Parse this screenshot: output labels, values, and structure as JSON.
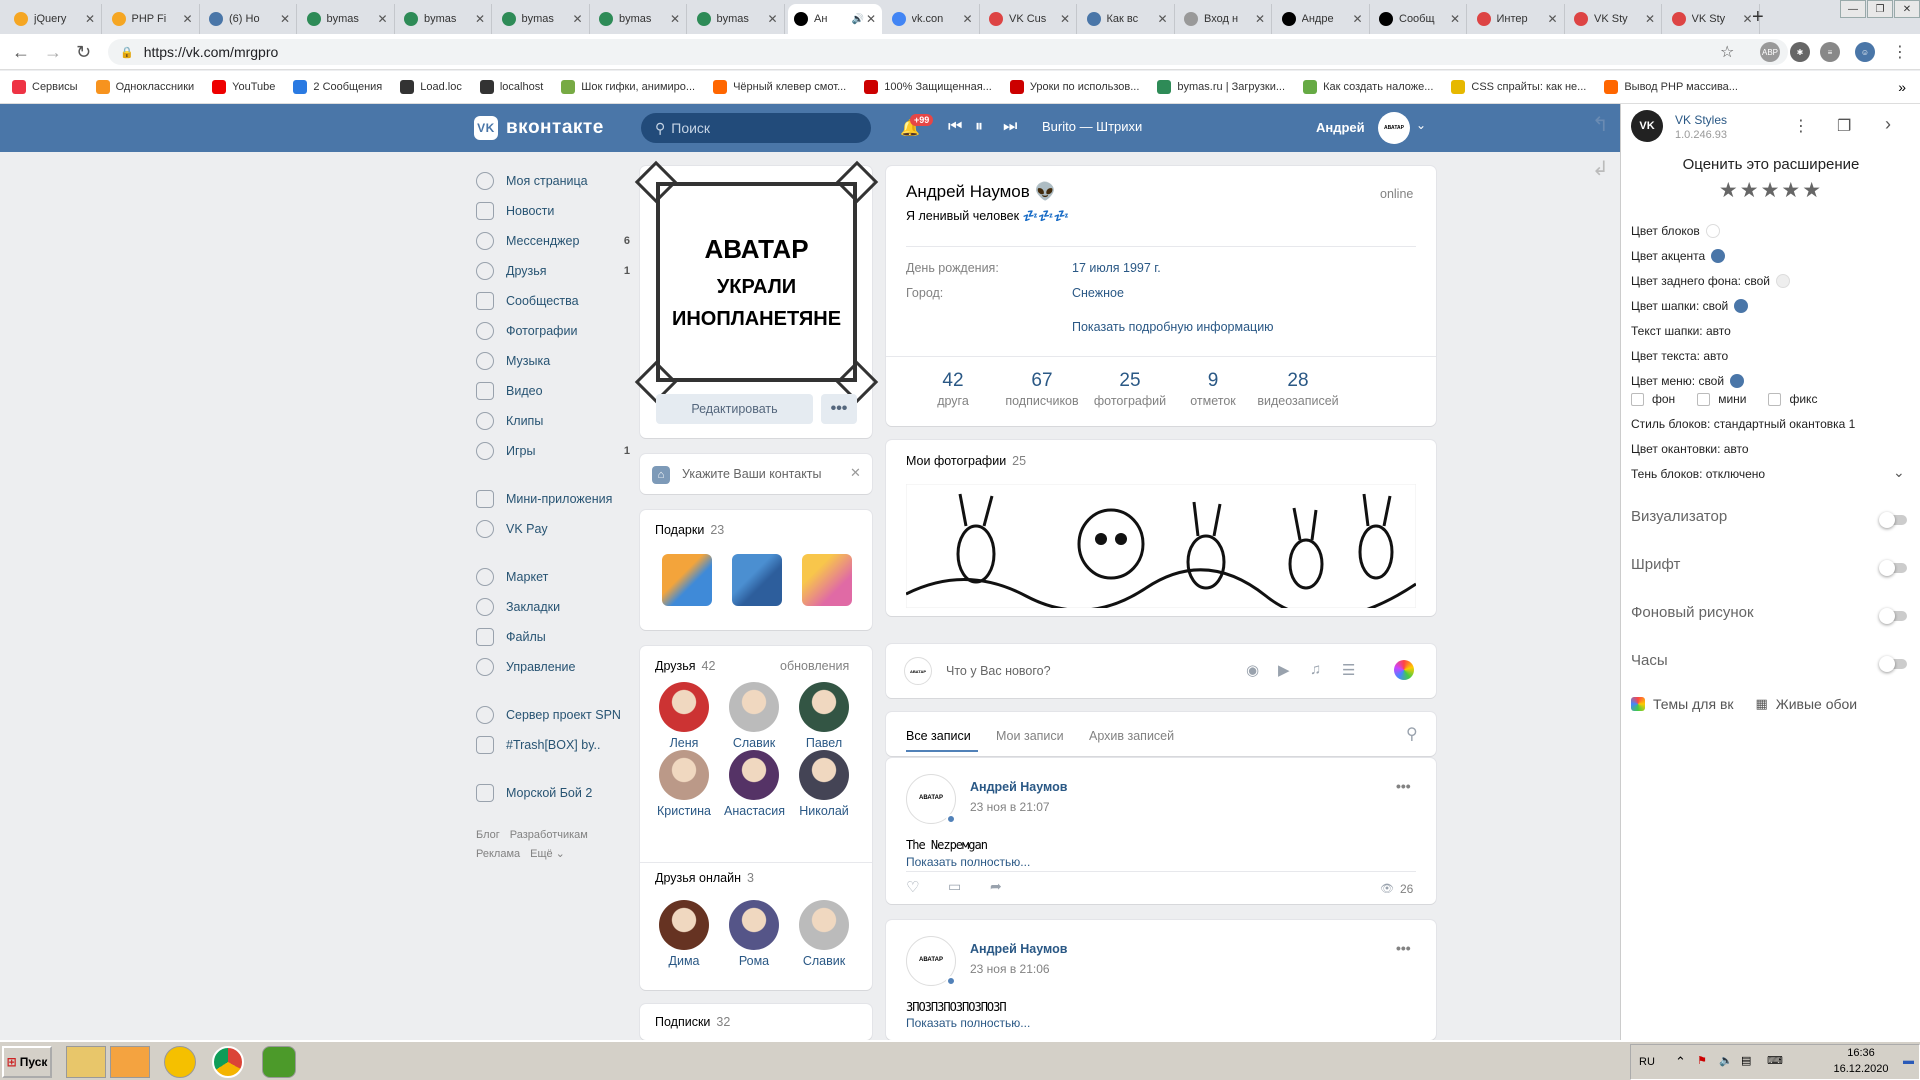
{
  "browser": {
    "tabs": [
      {
        "title": "jQuery",
        "color": "#f5a623"
      },
      {
        "title": "PHP Fi",
        "color": "#f5a623"
      },
      {
        "title": "(6) Но",
        "color": "#4a76a8"
      },
      {
        "title": "bymas",
        "color": "#2e8b57"
      },
      {
        "title": "bymas",
        "color": "#2e8b57"
      },
      {
        "title": "bymas",
        "color": "#2e8b57"
      },
      {
        "title": "bymas",
        "color": "#2e8b57"
      },
      {
        "title": "bymas",
        "color": "#2e8b57"
      },
      {
        "title": "Ан",
        "color": "#000000"
      },
      {
        "title": "vk.con",
        "color": "#4285f4"
      },
      {
        "title": "VK Cus",
        "color": "#d44"
      },
      {
        "title": "Как вс",
        "color": "#4a76a8"
      },
      {
        "title": "Вход н",
        "color": "#999999"
      },
      {
        "title": "Андре",
        "color": "#000000"
      },
      {
        "title": "Сообщ",
        "color": "#000000"
      },
      {
        "title": "Интер",
        "color": "#d44"
      },
      {
        "title": "VK Sty",
        "color": "#d44"
      },
      {
        "title": "VK Sty",
        "color": "#d44"
      }
    ],
    "new_tab": "+",
    "url": "https://vk.com/mrgpro",
    "bookmarks": [
      {
        "label": "Сервисы",
        "color": "#e34"
      },
      {
        "label": "Одноклассники",
        "color": "#f7931e"
      },
      {
        "label": "YouTube",
        "color": "#e00"
      },
      {
        "label": "2 Сообщения",
        "color": "#2a7ae2"
      },
      {
        "label": "Load.loc",
        "color": "#333"
      },
      {
        "label": "localhost",
        "color": "#333"
      },
      {
        "label": "Шок гифки, анимиро...",
        "color": "#7a4"
      },
      {
        "label": "Чёрный клевер смот...",
        "color": "#f60"
      },
      {
        "label": "100% Защищенная...",
        "color": "#c00"
      },
      {
        "label": "Уроки по использов...",
        "color": "#c00"
      },
      {
        "label": "bymas.ru | Загрузки...",
        "color": "#2e8b57"
      },
      {
        "label": "Как создать наложе...",
        "color": "#6a4"
      },
      {
        "label": "CSS спрайты: как не...",
        "color": "#e6b800"
      },
      {
        "label": "Вывод PHP массива...",
        "color": "#f60"
      }
    ]
  },
  "header": {
    "logo_text": "вконтакте",
    "search_placeholder": "Поиск",
    "notifications_badge": "+99",
    "track": "Burito — Штрихи",
    "user_name": "Андрей"
  },
  "menu": {
    "items": [
      {
        "label": "Моя страница",
        "count": ""
      },
      {
        "label": "Новости",
        "count": ""
      },
      {
        "label": "Мессенджер",
        "count": "6"
      },
      {
        "label": "Друзья",
        "count": "1"
      },
      {
        "label": "Сообщества",
        "count": ""
      },
      {
        "label": "Фотографии",
        "count": ""
      },
      {
        "label": "Музыка",
        "count": ""
      },
      {
        "label": "Видео",
        "count": ""
      },
      {
        "label": "Клипы",
        "count": ""
      },
      {
        "label": "Игры",
        "count": "1"
      }
    ],
    "items2": [
      {
        "label": "Мини-приложения"
      },
      {
        "label": "VK Pay"
      }
    ],
    "items3": [
      {
        "label": "Маркет"
      },
      {
        "label": "Закладки"
      },
      {
        "label": "Файлы"
      },
      {
        "label": "Управление"
      }
    ],
    "items4": [
      {
        "label": "Сервер проект SPN"
      },
      {
        "label": "#Trash[BOX] by.."
      }
    ],
    "items5": [
      {
        "label": "Морской Бой 2"
      }
    ],
    "footer": [
      "Блог",
      "Разработчикам",
      "Реклама",
      "Ещё ⌄"
    ]
  },
  "avatar": {
    "line1": "АВАТАР",
    "line2": "УКРАЛИ",
    "line3": "ИНОПЛАНЕТЯНЕ",
    "edit_label": "Редактировать",
    "more_label": "•••"
  },
  "contacts_prompt": "Укажите Ваши контакты",
  "gifts": {
    "title": "Подарки",
    "count": "23"
  },
  "friends": {
    "title": "Друзья",
    "count": "42",
    "updates": "обновления",
    "list": [
      {
        "name": "Леня",
        "color": "#c33"
      },
      {
        "name": "Славик",
        "color": "#bbb"
      },
      {
        "name": "Павел",
        "color": "#354"
      },
      {
        "name": "Кристина",
        "color": "#b98"
      },
      {
        "name": "Анастасия",
        "color": "#536"
      },
      {
        "name": "Николай",
        "color": "#445"
      }
    ]
  },
  "friends_online": {
    "title": "Друзья онлайн",
    "count": "3",
    "list": [
      {
        "name": "Дима",
        "color": "#632"
      },
      {
        "name": "Рома",
        "color": "#558"
      },
      {
        "name": "Славик",
        "color": "#bbb"
      }
    ]
  },
  "subscriptions": {
    "title": "Подписки",
    "count": "32"
  },
  "profile": {
    "name": "Андрей Наумов 👽",
    "status": "Я ленивый человек 💤💤💤",
    "online": "online",
    "birthday_label": "День рождения:",
    "birthday_value": "17 июля 1997 г.",
    "city_label": "Город:",
    "city_value": "Снежное",
    "more_info": "Показать подробную информацию",
    "counters": [
      {
        "n": "42",
        "l": "друга"
      },
      {
        "n": "67",
        "l": "подписчиков"
      },
      {
        "n": "25",
        "l": "фотографий"
      },
      {
        "n": "9",
        "l": "отметок"
      },
      {
        "n": "28",
        "l": "видеозаписей"
      }
    ]
  },
  "photos": {
    "title": "Мои фотографии",
    "count": "25"
  },
  "composer": {
    "placeholder": "Что у Вас нового?"
  },
  "wall_tabs": [
    "Все записи",
    "Мои записи",
    "Архив записей"
  ],
  "posts": [
    {
      "author": "Андрей Наумов",
      "date": "23 ноя в 21:07",
      "text": "The Nezpeмgan",
      "more": "Показать полностью...",
      "views": "26"
    },
    {
      "author": "Андрей Наумов",
      "date": "23 ноя в 21:06",
      "text": "ЗПОЗПЗПОЗПОЗПОЗП",
      "more": "Показать полностью..."
    }
  ],
  "vkstyles": {
    "name": "VK Styles",
    "version": "1.0.246.93",
    "rate": "Оценить это расширение",
    "stars": "★★★★★",
    "rows": [
      {
        "label": "Цвет блоков",
        "dot": "#ffffff"
      },
      {
        "label": "Цвет акцента",
        "dot": "#4a76a8"
      },
      {
        "label": "Цвет заднего фона: свой",
        "dot": "#eeeeee"
      },
      {
        "label": "Цвет шапки: свой",
        "dot": "#4a76a8"
      },
      {
        "label": "Текст шапки: авто",
        "dot": ""
      },
      {
        "label": "Цвет текста: авто",
        "dot": ""
      },
      {
        "label": "Цвет меню: свой",
        "dot": "#4a76a8"
      }
    ],
    "checks": [
      "фон",
      "мини",
      "фикс"
    ],
    "rows2": [
      "Стиль блоков: стандартный окантовка 1",
      "Цвет окантовки: авто",
      "Тень блоков: отключено"
    ],
    "toggles": [
      "Визуализатор",
      "Шрифт",
      "Фоновый рисунок",
      "Часы"
    ],
    "themes": "Темы для вк",
    "live": "Живые обои"
  },
  "taskbar": {
    "start": "Пуск",
    "lang": "RU",
    "time": "16:36",
    "date": "16.12.2020"
  }
}
